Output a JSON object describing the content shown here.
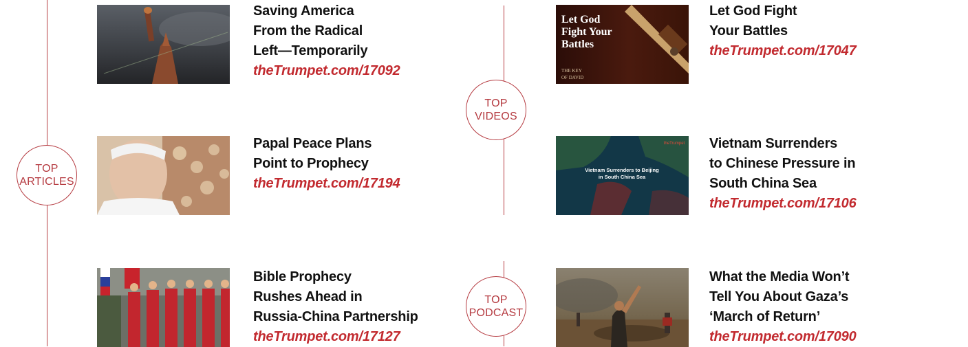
{
  "sections": {
    "articles": {
      "line1": "TOP",
      "line2": "ARTICLES"
    },
    "videos": {
      "line1": "TOP",
      "line2": "VIDEOS"
    },
    "podcast": {
      "line1": "TOP",
      "line2": "PODCAST"
    }
  },
  "articles": [
    {
      "title_lines": [
        "Saving America",
        "From the Radical",
        "Left—Temporarily"
      ],
      "link": "theTrumpet.com/17092",
      "image": "statue-of-liberty-storm"
    },
    {
      "title_lines": [
        "Papal Peace Plans",
        "Point to Prophecy"
      ],
      "link": "theTrumpet.com/17194",
      "image": "pope-portrait"
    },
    {
      "title_lines": [
        "Bible Prophecy",
        "Rushes Ahead in",
        "Russia-China Partnership"
      ],
      "link": "theTrumpet.com/17127",
      "image": "military-parade"
    }
  ],
  "videos": [
    {
      "title_lines": [
        "Let God Fight",
        "Your Battles"
      ],
      "link": "theTrumpet.com/17047",
      "image": "sword-video-thumbnail",
      "thumb_text": [
        "Let God",
        "Fight Your",
        "Battles"
      ],
      "thumb_logo": [
        "THE KEY",
        "OF DAVID"
      ]
    },
    {
      "title_lines": [
        "Vietnam Surrenders",
        "to Chinese Pressure in",
        "South China Sea"
      ],
      "link": "theTrumpet.com/17106",
      "image": "south-china-sea-map",
      "thumb_text": [
        "Vietnam Surrenders to Beijing",
        "in South China Sea"
      ],
      "thumb_brand": "theTrumpet"
    }
  ],
  "podcast": [
    {
      "title_lines": [
        "What the Media Won’t",
        "Tell You About Gaza’s",
        "‘March of Return’"
      ],
      "link": "theTrumpet.com/17090",
      "image": "gaza-protest"
    }
  ],
  "colors": {
    "accent": "#b53a40",
    "link": "#c22a2f",
    "title": "#111111"
  }
}
